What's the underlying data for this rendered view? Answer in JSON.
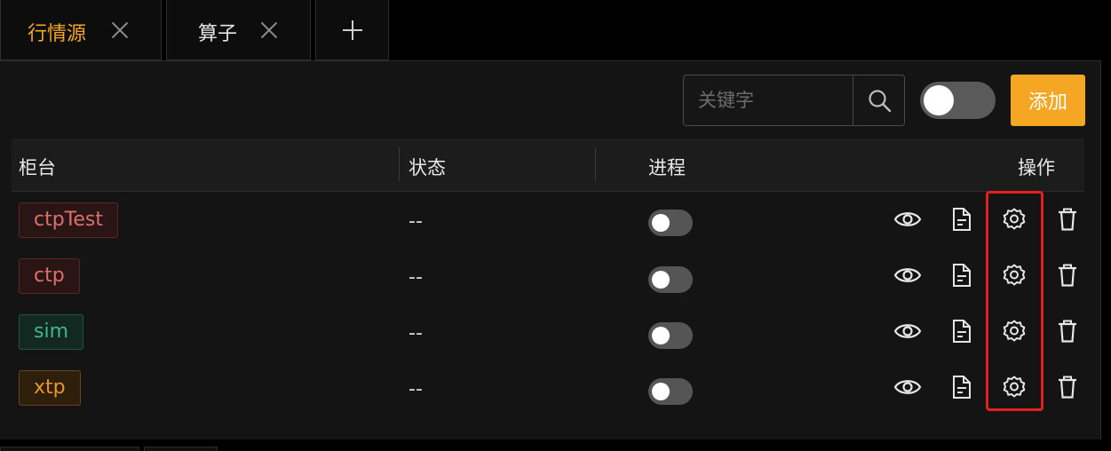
{
  "tabs": [
    {
      "label": "行情源",
      "color": "#f5a623",
      "active": true
    },
    {
      "label": "算子",
      "color": "#e6e6e6",
      "active": false
    }
  ],
  "toolbar": {
    "search_placeholder": "关键字",
    "add_label": "添加",
    "toggle_on": false
  },
  "table": {
    "headers": [
      "柜台",
      "状态",
      "进程",
      "操作"
    ],
    "rows": [
      {
        "counter": "ctpTest",
        "tag_color": "red",
        "status": "--",
        "process_on": false
      },
      {
        "counter": "ctp",
        "tag_color": "red",
        "status": "--",
        "process_on": false
      },
      {
        "counter": "sim",
        "tag_color": "green",
        "status": "--",
        "process_on": false
      },
      {
        "counter": "xtp",
        "tag_color": "orange",
        "status": "--",
        "process_on": false
      }
    ],
    "action_icons": [
      "eye-icon",
      "document-icon",
      "gear-icon",
      "trash-icon"
    ]
  },
  "colors": {
    "accent": "#f5a623",
    "highlight": "#e0211f",
    "tag_red": "#d9706c",
    "tag_green": "#3fb88a",
    "tag_orange": "#e8962c"
  }
}
